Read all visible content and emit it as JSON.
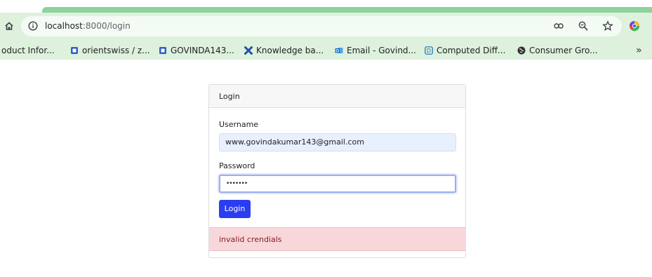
{
  "browser": {
    "url_host": "localhost",
    "url_path": ":8000/login",
    "bookmarks": [
      {
        "label": "oduct Infor...",
        "icon": "none"
      },
      {
        "label": "orientswiss / z...",
        "icon": "azure-devops-icon",
        "color": "#2f5fd0"
      },
      {
        "label": "GOVINDA143...",
        "icon": "azure-devops-icon",
        "color": "#2f5fd0"
      },
      {
        "label": "Knowledge ba...",
        "icon": "confluence-x-icon",
        "color": "#1f4fb0"
      },
      {
        "label": "Email - Govind...",
        "icon": "outlook-icon",
        "color": "#0a66c2"
      },
      {
        "label": "Computed Diff...",
        "icon": "d-square-icon",
        "color": "#1f6fb5"
      },
      {
        "label": "Consumer Gro...",
        "icon": "globe-icon",
        "color": "#333333"
      }
    ],
    "more_label": "»"
  },
  "login": {
    "header": "Login",
    "username_label": "Username",
    "username_value": "www.govindakumar143@gmail.com",
    "password_label": "Password",
    "password_value": "•••••••",
    "submit_label": "Login",
    "error": "invalid crendials"
  },
  "colors": {
    "primary": "#2b3df1",
    "alert_bg": "#f8d7da",
    "alert_text": "#8a1c23",
    "chrome": "#ddf1dd"
  }
}
